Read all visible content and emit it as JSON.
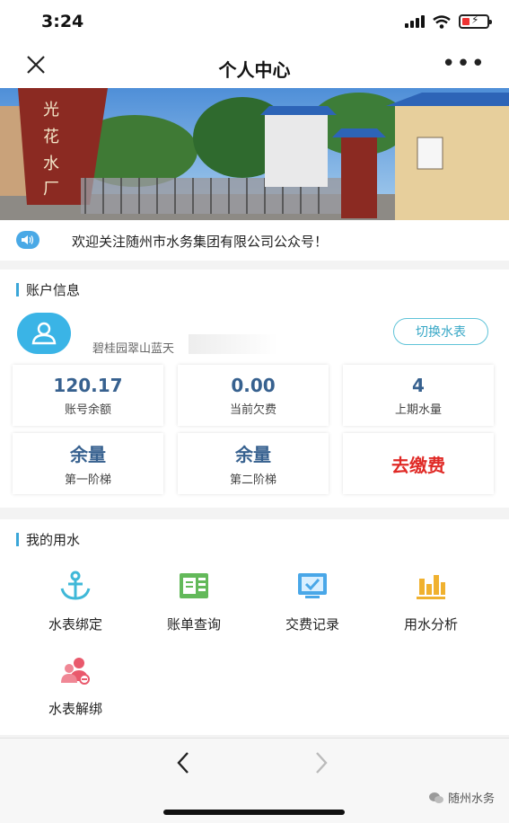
{
  "status_bar": {
    "time": "3:24"
  },
  "nav": {
    "title": "个人中心",
    "more": "•••"
  },
  "notice": {
    "text": "欢迎关注随州市水务集团有限公司公众号！"
  },
  "account": {
    "section_title": "账户信息",
    "address": "碧桂园翠山蓝天",
    "switch_label": "切换水表",
    "stats": {
      "balance": {
        "value": "120.17",
        "label": "账号余额"
      },
      "arrears": {
        "value": "0.00",
        "label": "当前欠费"
      },
      "last_usage": {
        "value": "4",
        "label": "上期水量"
      },
      "tier1": {
        "value": "余量",
        "label": "第一阶梯"
      },
      "tier2": {
        "value": "余量",
        "label": "第二阶梯"
      },
      "pay": {
        "label": "去缴费"
      }
    }
  },
  "water": {
    "section_title": "我的用水",
    "items": [
      {
        "label": "水表绑定",
        "icon": "anchor-icon",
        "color": "#3fb8d8"
      },
      {
        "label": "账单查询",
        "icon": "bill-icon",
        "color": "#63b95a"
      },
      {
        "label": "交费记录",
        "icon": "payment-record-icon",
        "color": "#49a7e8"
      },
      {
        "label": "用水分析",
        "icon": "bar-chart-icon",
        "color": "#f0b12f"
      },
      {
        "label": "水表解绑",
        "icon": "unbind-icon",
        "color": "#e9596c"
      }
    ]
  },
  "bottom": {
    "back": "<",
    "forward": ">",
    "watermark": "随州水务"
  },
  "colors": {
    "accent": "#3aa6d8",
    "value": "#37618f",
    "pay": "#e02a26"
  }
}
